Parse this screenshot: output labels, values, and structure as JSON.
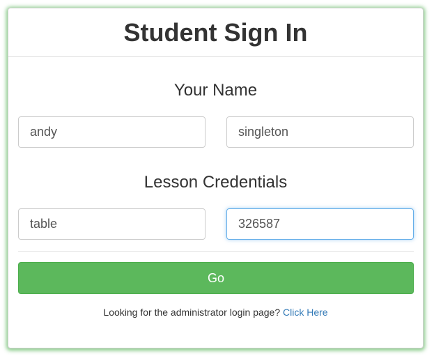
{
  "header": {
    "title": "Student Sign In"
  },
  "name_section": {
    "heading": "Your Name",
    "first_name_value": "andy",
    "last_name_value": "singleton"
  },
  "credentials_section": {
    "heading": "Lesson Credentials",
    "lesson_value": "table",
    "code_value": "326587"
  },
  "actions": {
    "go_label": "Go"
  },
  "footer": {
    "prompt": "Looking for the administrator login page?",
    "link_label": "Click Here"
  },
  "colors": {
    "accent": "#5cb85c",
    "link": "#337ab7",
    "focus": "#66afe9"
  }
}
